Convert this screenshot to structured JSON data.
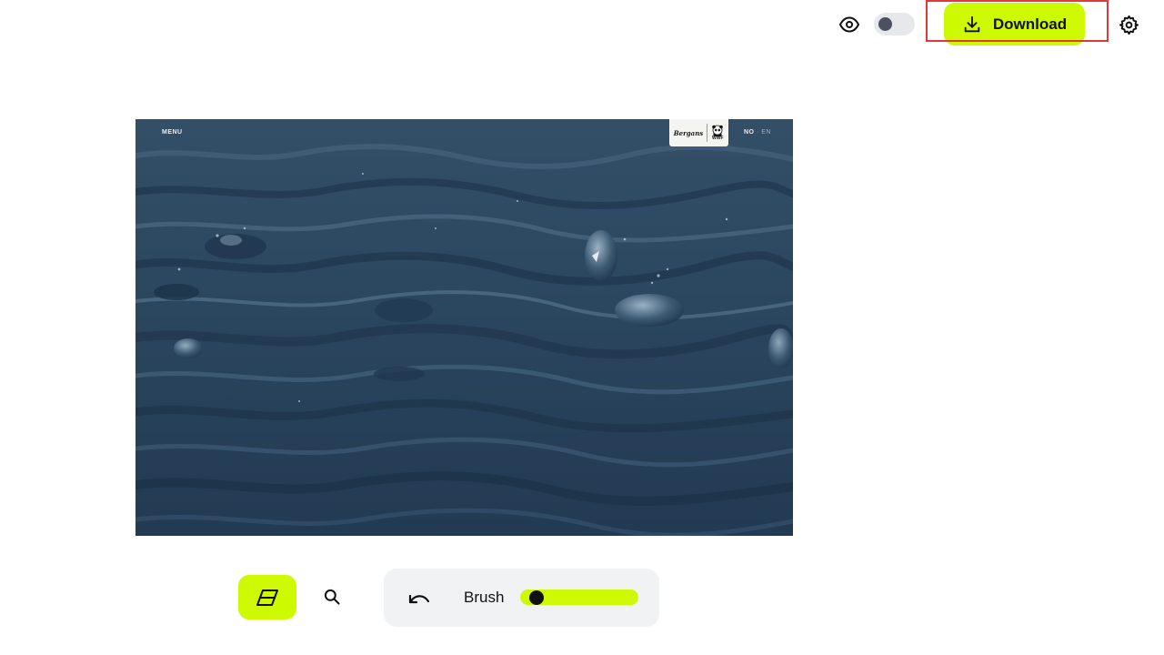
{
  "toolbar": {
    "download_label": "Download",
    "preview_toggle_on": false
  },
  "canvas_image": {
    "site_menu_label": "MENU",
    "site_logo_text": "Bergans",
    "site_logo_partner": "WWF",
    "site_lang_active": "NO",
    "site_lang_separator": "·",
    "site_lang_inactive": "EN"
  },
  "tools": {
    "brush_label": "Brush",
    "brush_size": 0.05
  },
  "colors": {
    "accent": "#cdfa00",
    "panel": "#f1f2f4",
    "highlight": "#e0383b"
  },
  "icons": [
    "eye-icon",
    "download-icon",
    "gear-icon",
    "eraser-icon",
    "search-icon",
    "undo-icon"
  ]
}
